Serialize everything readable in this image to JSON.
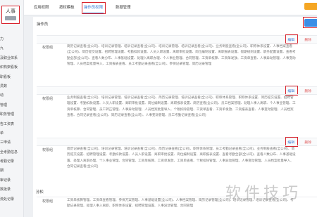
{
  "sidebar": {
    "active_label": "人事",
    "items": [
      "力",
      "九",
      "及职业体系",
      "织构架看板",
      "职看板",
      "员数",
      "动",
      "管理",
      "职务管理",
      "告工资表",
      "单",
      "三申请",
      "全考勤信息",
      "考勤记录",
      "期",
      "审记录",
      "数批录",
      "流处记录"
    ]
  },
  "tabs": [
    "应用权限",
    "按权模板",
    "操作员权限",
    "数据管理"
  ],
  "page_title": "操作员",
  "actions": {
    "edit": "编辑",
    "delete": "删除"
  },
  "blocks": [
    {
      "label": "权限组",
      "text": "简历记录查看(全公司)、培训记录管理、培训记录查看(全公司)、培训记录管理、培训记录查看(全公司)、业务制股查看(全公司)、职称体系设置、人事档案查看(全公司)、简历提交设置、招聘管理设置、考勤扣款设置、人员入职设置、离职审批设置、岗位编制设置、离职报表设置、假期规则设置、职务配置设置、查看考勤全部(全公司)、查看人数分布、人事基础设置、处理入离职办理、个人事业管理、合同管理、工资单核算、工资单发放、工资单查看、人事异动管理、人事变动管理、人员档案批量导入、工资报表查看、员工考勤记录查看(全公司)、参保记录管理、简历记录管理"
    },
    {
      "label": "权限组",
      "text": "业务制股查看(全公司)、培训记录管理、培训记录查看(全公司)、简历记录管理、培训记录查看(全公司)、职称体系管理、职称体系设置、简历提交设置、招聘管理设置、考勤扣款设置、人员入职设置、离职审批设置、岗位编制设置、离职报表设置、简历查看(全公司)、员工档案管理、处理人事入离职、个人事业管理、工资单核算、合同管理、员工转正管理、人事异动管理、人员档案批量导入、个税扣除管理、工资单查看、工资单发放、工资报表查看、人事变动管理、人员档案查看、合同记录查看(全公司)、简历记录查看(全公司)、人事变动管理、员工考勤记录查看(全公司)"
    },
    {
      "label": "权限组",
      "text": "简历记录查看(全公司)、培训记录管理、培训记录查看(全公司)、简历记录查看(全公司)、职称体系管理、员工考勤记录查看(全公司)、业务制股查看(全公司)、简历提交设置、招聘管理设置、考勤扣款设置、人员入职设置、离职审批设置、岗位编制设置、离职报表设置、查看考勤全部(全公司)、查看人数分布、人事基础设置、处理入离职办理、个人事业管理、合同管理、工资单核算、工资单发放、工资单查看、个税扣除管理、人事异动管理、人事变动管理、人员档案批量导入、合同记录查看(全公司)"
    },
    {
      "group": "孙松",
      "label": "权限组",
      "text": "工资单核算管理、工资单查看管理、参保方案管理、人事基础设置(全公司)、人事档案管理、简历记录管理(全公司)、培训记录管理、培训记录查看(全公司)、考勤记录管理、处理人事入离职、职称体系设置、招聘管理设置、人事异动管理、合同管理"
    }
  ]
}
